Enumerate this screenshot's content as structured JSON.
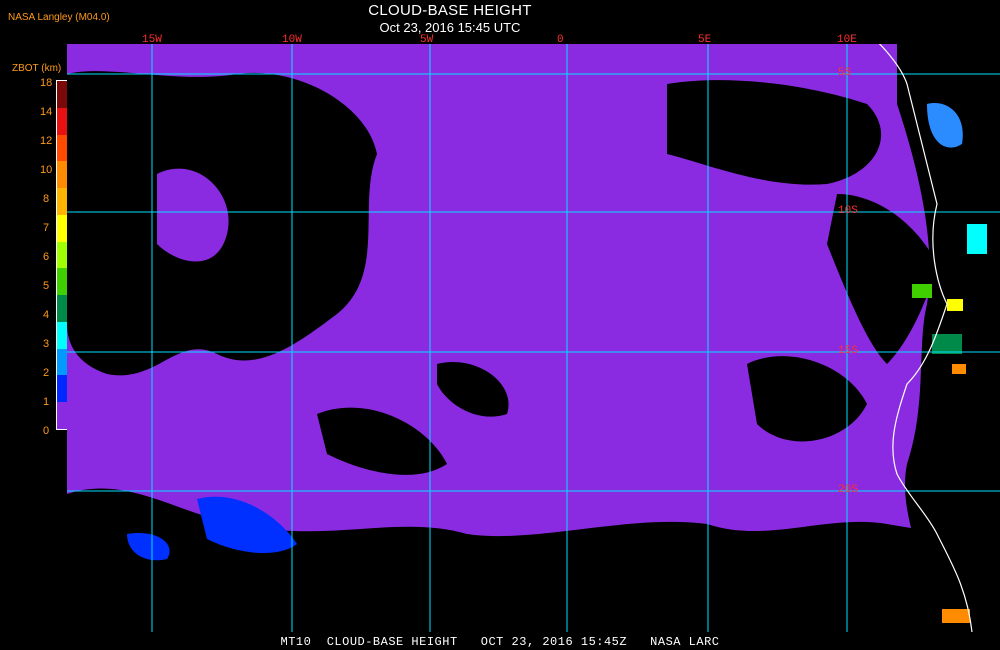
{
  "header": {
    "title": "CLOUD-BASE HEIGHT",
    "subtitle": "Oct 23, 2016 15:45 UTC",
    "producer": "NASA Langley (M04.0)"
  },
  "colorbar": {
    "title": "ZBOT (km)",
    "labels": [
      "18",
      "14",
      "12",
      "10",
      "8",
      "7",
      "6",
      "5",
      "4",
      "3",
      "2",
      "1",
      "0"
    ],
    "colors": [
      "#7a0a0a",
      "#e81010",
      "#ff4a00",
      "#ff8c00",
      "#ffb400",
      "#ffff00",
      "#a0ff00",
      "#40d000",
      "#008a4a",
      "#00ffff",
      "#009aff",
      "#0028ff",
      "#8a2be2"
    ]
  },
  "map": {
    "ocean_color": "#8a2be2",
    "cloudfree_color": "#000000",
    "grid_color": "#00e0ff",
    "coast_color": "#ffffff",
    "lon_labels": [
      "15W",
      "10W",
      "5W",
      "0",
      "5E",
      "10E"
    ],
    "lat_labels": [
      "5S",
      "10S",
      "15S",
      "20S"
    ]
  },
  "footer": {
    "text": "MT10  CLOUD-BASE HEIGHT   OCT 23, 2016 15:45Z   NASA LARC"
  }
}
